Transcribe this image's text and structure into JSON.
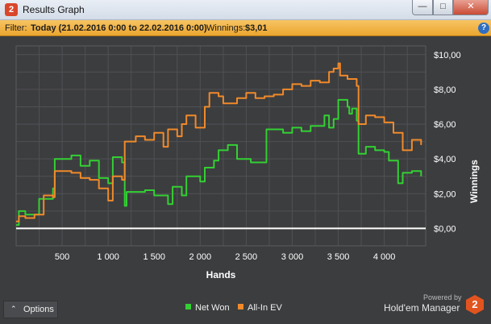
{
  "window": {
    "title": "Results Graph",
    "app_icon": "2",
    "buttons": {
      "minimize": "—",
      "maximize": "□",
      "close": "✕"
    }
  },
  "filter": {
    "label": "Filter:",
    "value": "Today (21.02.2016 0:00 to 22.02.2016 0:00)",
    "winnings_label": "Winnings:",
    "winnings_value": "$3,01",
    "help": "?"
  },
  "colors": {
    "net_won": "#33d033",
    "all_in_ev": "#f08a2a",
    "zero_line": "#ffffff",
    "grid": "#505154",
    "plot_bg": "#3c3d3f"
  },
  "chart_data": {
    "type": "line",
    "xlabel": "Hands",
    "ylabel": "Winnings",
    "xlim": [
      0,
      4450
    ],
    "ylim": [
      -1,
      10.5
    ],
    "x_ticks": [
      500,
      1000,
      1500,
      2000,
      2500,
      3000,
      3500,
      4000
    ],
    "x_tick_labels": [
      "500",
      "1 000",
      "1 500",
      "2 000",
      "2 500",
      "3 000",
      "3 500",
      "4 000"
    ],
    "y_ticks": [
      0,
      2,
      4,
      6,
      8,
      10
    ],
    "y_tick_labels": [
      "$0,00",
      "$2,00",
      "$4,00",
      "$6,00",
      "$8,00",
      "$10,00"
    ],
    "series": [
      {
        "name": "Net Won",
        "points": [
          [
            0,
            0.2
          ],
          [
            30,
            1.0
          ],
          [
            100,
            0.8
          ],
          [
            250,
            1.7
          ],
          [
            400,
            2.3
          ],
          [
            420,
            4.0
          ],
          [
            600,
            4.2
          ],
          [
            700,
            3.6
          ],
          [
            800,
            3.9
          ],
          [
            900,
            2.9
          ],
          [
            1000,
            2.6
          ],
          [
            1050,
            4.1
          ],
          [
            1150,
            3.8
          ],
          [
            1180,
            1.3
          ],
          [
            1200,
            2.1
          ],
          [
            1400,
            2.2
          ],
          [
            1500,
            1.9
          ],
          [
            1650,
            1.4
          ],
          [
            1700,
            2.4
          ],
          [
            1800,
            1.9
          ],
          [
            1850,
            3.0
          ],
          [
            2000,
            2.7
          ],
          [
            2050,
            3.5
          ],
          [
            2150,
            3.9
          ],
          [
            2200,
            4.5
          ],
          [
            2300,
            4.8
          ],
          [
            2400,
            4.0
          ],
          [
            2550,
            3.8
          ],
          [
            2700,
            3.8
          ],
          [
            2720,
            5.7
          ],
          [
            2900,
            5.5
          ],
          [
            3000,
            5.8
          ],
          [
            3100,
            5.6
          ],
          [
            3200,
            5.9
          ],
          [
            3350,
            6.5
          ],
          [
            3400,
            5.8
          ],
          [
            3450,
            6.3
          ],
          [
            3500,
            7.4
          ],
          [
            3600,
            7.0
          ],
          [
            3620,
            6.6
          ],
          [
            3650,
            6.9
          ],
          [
            3700,
            6.2
          ],
          [
            3720,
            4.3
          ],
          [
            3800,
            4.7
          ],
          [
            3900,
            4.5
          ],
          [
            4000,
            4.4
          ],
          [
            4050,
            3.9
          ],
          [
            4150,
            2.6
          ],
          [
            4200,
            3.2
          ],
          [
            4300,
            3.3
          ],
          [
            4400,
            3.0
          ]
        ]
      },
      {
        "name": "All-In EV",
        "points": [
          [
            0,
            0.4
          ],
          [
            30,
            0.7
          ],
          [
            100,
            0.6
          ],
          [
            200,
            0.8
          ],
          [
            300,
            1.9
          ],
          [
            400,
            1.8
          ],
          [
            420,
            3.3
          ],
          [
            600,
            3.2
          ],
          [
            700,
            2.9
          ],
          [
            800,
            2.8
          ],
          [
            900,
            2.3
          ],
          [
            1000,
            1.6
          ],
          [
            1050,
            3.0
          ],
          [
            1150,
            2.8
          ],
          [
            1180,
            5.0
          ],
          [
            1300,
            5.3
          ],
          [
            1400,
            5.1
          ],
          [
            1500,
            5.5
          ],
          [
            1600,
            4.7
          ],
          [
            1650,
            5.7
          ],
          [
            1750,
            5.3
          ],
          [
            1800,
            6.0
          ],
          [
            1850,
            6.5
          ],
          [
            1950,
            5.8
          ],
          [
            2050,
            7.0
          ],
          [
            2100,
            7.8
          ],
          [
            2200,
            7.6
          ],
          [
            2250,
            7.2
          ],
          [
            2400,
            7.5
          ],
          [
            2500,
            7.8
          ],
          [
            2600,
            7.5
          ],
          [
            2700,
            7.6
          ],
          [
            2800,
            7.7
          ],
          [
            2900,
            8.0
          ],
          [
            3000,
            8.3
          ],
          [
            3100,
            8.2
          ],
          [
            3200,
            8.5
          ],
          [
            3300,
            8.4
          ],
          [
            3400,
            9.0
          ],
          [
            3450,
            9.2
          ],
          [
            3500,
            9.5
          ],
          [
            3520,
            8.8
          ],
          [
            3600,
            8.6
          ],
          [
            3700,
            8.2
          ],
          [
            3720,
            6.0
          ],
          [
            3800,
            6.5
          ],
          [
            3900,
            6.4
          ],
          [
            4000,
            6.1
          ],
          [
            4100,
            5.5
          ],
          [
            4200,
            4.5
          ],
          [
            4300,
            5.1
          ],
          [
            4400,
            4.8
          ]
        ]
      }
    ]
  },
  "footer": {
    "options_label": "Options",
    "options_arrow": "⌃",
    "legend_net": "Net Won",
    "legend_ev": "All-In EV",
    "powered_by": "Powered by",
    "brand": "Hold'em Manager",
    "brand_logo": "2"
  }
}
